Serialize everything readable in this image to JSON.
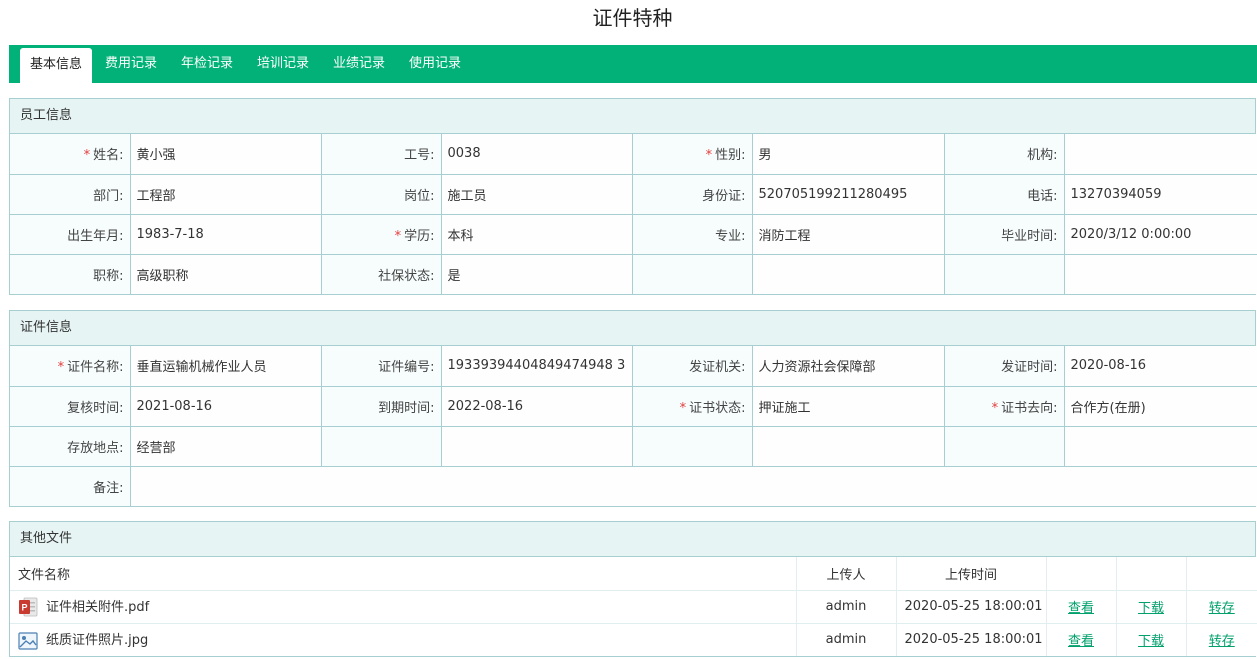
{
  "title": "证件特种",
  "tabs": [
    {
      "label": "基本信息",
      "active": true
    },
    {
      "label": "费用记录",
      "active": false
    },
    {
      "label": "年检记录",
      "active": false
    },
    {
      "label": "培训记录",
      "active": false
    },
    {
      "label": "业绩记录",
      "active": false
    },
    {
      "label": "使用记录",
      "active": false
    }
  ],
  "employee": {
    "heading": "员工信息",
    "name_label": "姓名:",
    "name": "黄小强",
    "job_no_label": "工号:",
    "job_no": "0038",
    "gender_label": "性别:",
    "gender": "男",
    "org_label": "机构:",
    "org": "",
    "dept_label": "部门:",
    "dept": "工程部",
    "post_label": "岗位:",
    "post": "施工员",
    "id_card_label": "身份证:",
    "id_card": "520705199211280495",
    "phone_label": "电话:",
    "phone": "13270394059",
    "birth_label": "出生年月:",
    "birth": "1983-7-18",
    "edu_label": "学历:",
    "edu": "本科",
    "major_label": "专业:",
    "major": "消防工程",
    "grad_label": "毕业时间:",
    "grad": "2020/3/12 0:00:00",
    "title_label": "职称:",
    "job_title": "高级职称",
    "social_label": "社保状态:",
    "social": "是"
  },
  "certificate": {
    "heading": "证件信息",
    "cert_name_label": "证件名称:",
    "cert_name": "垂直运输机械作业人员",
    "cert_no_label": "证件编号:",
    "cert_no": "19339394404849474948 3",
    "issuer_label": "发证机关:",
    "issuer": "人力资源社会保障部",
    "issue_date_label": "发证时间:",
    "issue_date": "2020-08-16",
    "review_label": "复核时间:",
    "review": "2021-08-16",
    "expire_label": "到期时间:",
    "expire": "2022-08-16",
    "status_label": "证书状态:",
    "status": "押证施工",
    "dest_label": "证书去向:",
    "dest": "合作方(在册)",
    "store_label": "存放地点:",
    "store": "经营部",
    "remark_label": "备注:",
    "remark": ""
  },
  "files": {
    "heading": "其他文件",
    "col_name": "文件名称",
    "col_uploader": "上传人",
    "col_time": "上传时间",
    "view_label": "查看",
    "download_label": "下载",
    "save_label": "转存",
    "rows": [
      {
        "name": "证件相关附件.pdf",
        "uploader": "admin",
        "time": "2020-05-25 18:00:01",
        "icon": "pdf-file-icon"
      },
      {
        "name": "纸质证件照片.jpg",
        "uploader": "admin",
        "time": "2020-05-25 18:00:01",
        "icon": "image-file-icon"
      }
    ]
  },
  "colors": {
    "accent": "#01b177",
    "border": "#a7cfd1",
    "link": "#01a06c",
    "required": "#e43b3b"
  }
}
